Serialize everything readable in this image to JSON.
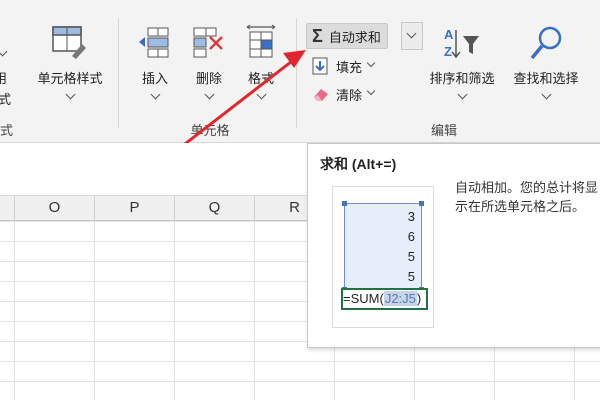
{
  "ribbon": {
    "format_left_group_label": "式",
    "cell_style": {
      "label": "单元格样式"
    },
    "left_partial_labels": [
      "用",
      "式"
    ],
    "cells_group": {
      "label": "单元格",
      "insert": "插入",
      "delete": "删除",
      "format": "格式"
    },
    "edit_group": {
      "label": "编辑",
      "autosum": "自动求和",
      "fill": "填充",
      "clear": "清除",
      "sort_filter": "排序和筛选",
      "find_select": "查找和选择"
    }
  },
  "sheet": {
    "columns": [
      "O",
      "P",
      "Q",
      "R"
    ]
  },
  "tooltip": {
    "title": "求和 (Alt+=)",
    "description": "自动相加。您的总计将显示在所选单元格之后。",
    "cells": [
      "3",
      "6",
      "5",
      "5"
    ],
    "formula_prefix": "=SUM(",
    "formula_ref": "J2:J5",
    "formula_suffix": ")"
  },
  "colors": {
    "accent_arrow": "#e3262d",
    "selection_border": "#217346",
    "range_fill": "#e6eef9"
  }
}
